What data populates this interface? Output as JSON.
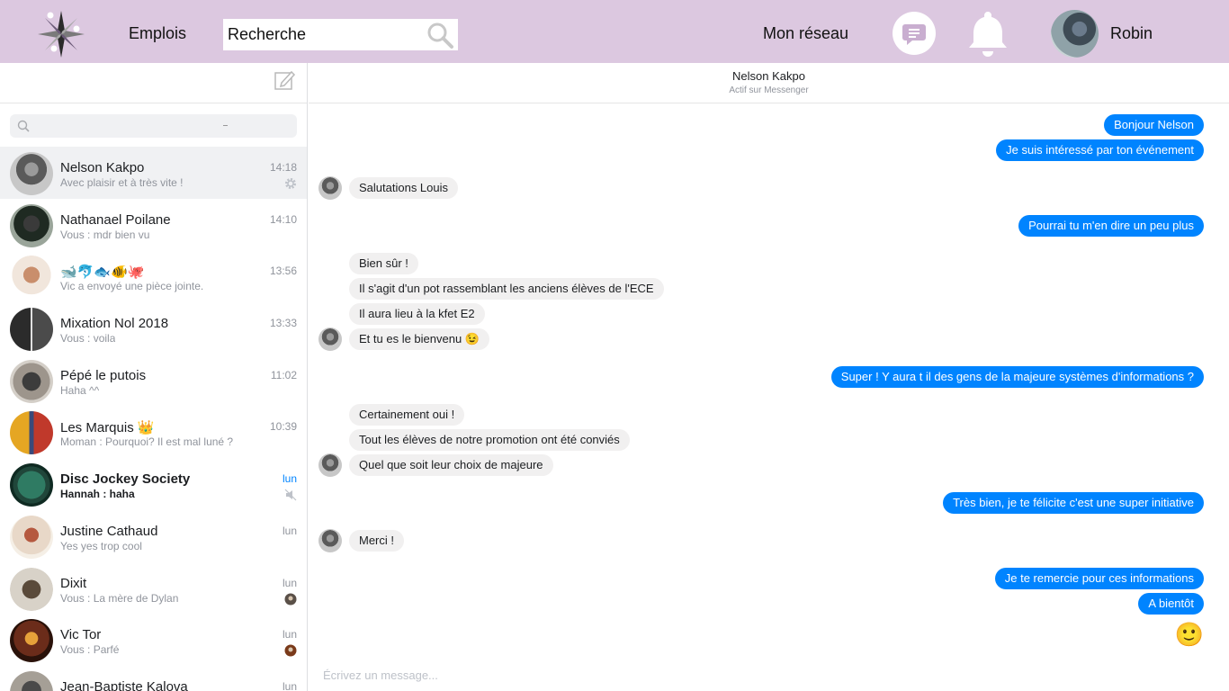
{
  "topbar": {
    "jobs_label": "Emplois",
    "search_placeholder": "Recherche",
    "network_label": "Mon réseau",
    "profile_name": "Robin"
  },
  "sidebar": {
    "search_placeholder": "",
    "conversations": [
      {
        "name": "Nelson Kakpo",
        "preview": "Avec plaisir et à très vite !",
        "time": "14:18",
        "active": true,
        "meta": "gear-icon"
      },
      {
        "name": "Nathanael Poilane",
        "preview": "Vous : mdr bien vu",
        "time": "14:10"
      },
      {
        "name": "🐋🐬🐟🐠🐙",
        "preview": "Vic a envoyé une pièce jointe.",
        "time": "13:56"
      },
      {
        "name": "Mixation Nol 2018",
        "preview": "Vous : voila",
        "time": "13:33"
      },
      {
        "name": "Pépé le putois",
        "preview": "Haha ^^",
        "time": "11:02"
      },
      {
        "name": "Les Marquis 👑",
        "preview": "Moman : Pourquoi? Il est mal luné ?",
        "time": "10:39"
      },
      {
        "name": "Disc Jockey Society",
        "preview": "Hannah : haha",
        "time": "lun",
        "unread": true,
        "meta": "muted-icon"
      },
      {
        "name": "Justine Cathaud",
        "preview": "Yes yes trop cool",
        "time": "lun"
      },
      {
        "name": "Dixit",
        "preview": "Vous : La mère de Dylan",
        "time": "lun",
        "meta": "seen-avatar-icon"
      },
      {
        "name": "Vic Tor",
        "preview": "Vous : Parfé",
        "time": "lun",
        "meta": "seen-avatar-icon"
      },
      {
        "name": "Jean-Baptiste Kalova",
        "preview": "",
        "time": "lun"
      }
    ]
  },
  "chat": {
    "contact_name": "Nelson Kakpo",
    "contact_status": "Actif sur Messenger",
    "messages": [
      {
        "dir": "out",
        "text": "Bonjour Nelson"
      },
      {
        "dir": "out",
        "text": "Je suis intéressé par ton événement"
      },
      {
        "dir": "in",
        "text": "Salutations Louis"
      },
      {
        "dir": "out",
        "text": "Pourrai tu m'en dire un peu plus"
      },
      {
        "dir": "in",
        "text": "Bien sûr !"
      },
      {
        "dir": "in",
        "text": "Il s'agit d'un pot rassemblant les anciens élèves de l'ECE"
      },
      {
        "dir": "in",
        "text": "Il aura lieu à la kfet E2"
      },
      {
        "dir": "in",
        "text": "Et tu es le bienvenu 😉"
      },
      {
        "dir": "out",
        "text": "Super !  Y aura t il des gens de la majeure systèmes d'informations ?"
      },
      {
        "dir": "in",
        "text": "Certainement oui !"
      },
      {
        "dir": "in",
        "text": "Tout les élèves de notre promotion ont été conviés"
      },
      {
        "dir": "in",
        "text": "Quel que soit leur choix de majeure"
      },
      {
        "dir": "out",
        "text": "Très bien, je te félicite c'est une super initiative"
      },
      {
        "dir": "in",
        "text": "Merci !"
      },
      {
        "dir": "out",
        "text": "Je te remercie pour ces informations"
      },
      {
        "dir": "out",
        "text": "A bientôt"
      }
    ],
    "reaction_emoji": "🙂",
    "composer_placeholder": "Écrivez un message..."
  },
  "colors": {
    "topbar": "#dcc8e0",
    "outgoing_bubble": "#0084ff",
    "incoming_bubble": "#f1f0f0",
    "unread_time": "#0084ff"
  }
}
